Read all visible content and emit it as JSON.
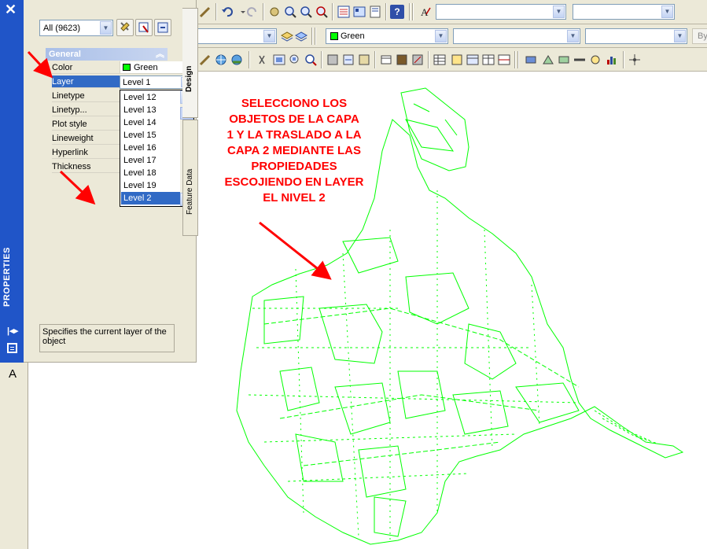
{
  "properties_panel": {
    "palette_title": "PROPERTIES",
    "selection_filter": "All (9623)",
    "group_header": "General",
    "rows": [
      {
        "name": "Color",
        "value": "Green"
      },
      {
        "name": "Layer",
        "value": "Level 1"
      },
      {
        "name": "Linetype",
        "value": ""
      },
      {
        "name": "Linetyp...",
        "value": ""
      },
      {
        "name": "Plot style",
        "value": ""
      },
      {
        "name": "Lineweight",
        "value": ""
      },
      {
        "name": "Hyperlink",
        "value": ""
      },
      {
        "name": "Thickness",
        "value": ""
      }
    ],
    "layer_dropdown": {
      "current": "Level 1",
      "options": [
        "Level 12",
        "Level 13",
        "Level 14",
        "Level 15",
        "Level 16",
        "Level 17",
        "Level 18",
        "Level 19",
        "Level 2"
      ],
      "highlighted": "Level 2"
    },
    "description": "Specifies the current layer of the object",
    "tabs": [
      "Design",
      "Feature Data"
    ]
  },
  "toolbar": {
    "color_combo": "Green",
    "bylayer_partial": "By"
  },
  "left_strip_button": "A",
  "annotation": {
    "text": "SELECCIONO LOS\nOBJETOS DE LA CAPA\n1 Y LA TRASLADO A LA\nCAPA 2 MEDIANTE LAS\nPROPIEDADES\nESCOJIENDO EN LAYER\nEL NIVEL 2",
    "color": "#ff0000"
  },
  "colors": {
    "drawing_lines": "#00ff00",
    "palette_blue": "#2055c8",
    "selection_blue": "#316ac5",
    "toolbar_bg": "#ece9d8"
  }
}
